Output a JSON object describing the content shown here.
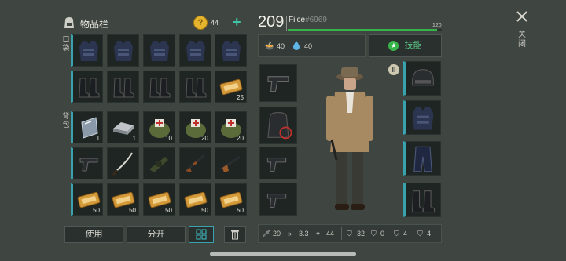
{
  "inventory": {
    "title": "物品栏",
    "coins": "44",
    "section_pockets": "口袋",
    "section_backpack": "背包",
    "counts": {
      "r2c5": "25",
      "r3c1": "1",
      "r3c2": "1",
      "r3c3": "10",
      "r3c4": "20",
      "r3c5": "20",
      "r5c2": "50",
      "r5c3": "50",
      "r5c4": "50",
      "r5c5": "50",
      "r5c1": "50"
    },
    "use_label": "使用",
    "split_label": "分开"
  },
  "character": {
    "level": "209",
    "name": "Filce",
    "tag": "#6969",
    "hp_max": "120",
    "hp_fraction": 0.97,
    "hunger": "40",
    "thirst": "40",
    "skills_label": "技能"
  },
  "close_label": "关闭",
  "stats": {
    "attack": "20",
    "speed": "3.3",
    "accuracy": "44",
    "armor": "32",
    "shield_a": "0",
    "shield_b": "4",
    "shield_c": "4"
  },
  "colors": {
    "accent": "#3aa2ad",
    "hp": "#38b54a",
    "coin": "#e6b530"
  }
}
